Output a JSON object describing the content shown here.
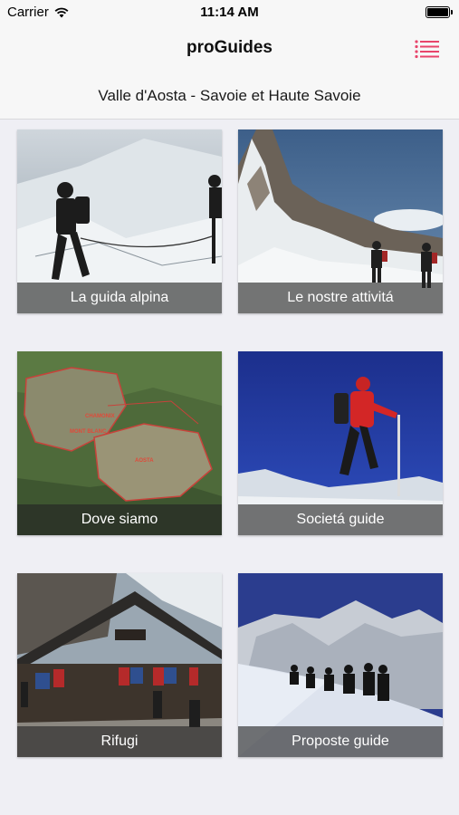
{
  "status_bar": {
    "carrier": "Carrier",
    "time": "11:14 AM",
    "icons": [
      "wifi-icon",
      "battery-icon"
    ]
  },
  "nav": {
    "title": "proGuides",
    "menu_icon": "menu-icon",
    "accent_color": "#e8456b"
  },
  "subheader": {
    "region": "Valle d'Aosta - Savoie et Haute Savoie"
  },
  "tiles": [
    {
      "label": "La guida alpina"
    },
    {
      "label": "Le nostre attivitá"
    },
    {
      "label": "Dove siamo"
    },
    {
      "label": "Societá guide"
    },
    {
      "label": "Rifugi"
    },
    {
      "label": "Proposte guide"
    }
  ],
  "map_place_names": [
    "AOSTA",
    "MONT BLANC",
    "CHAMONIX"
  ]
}
